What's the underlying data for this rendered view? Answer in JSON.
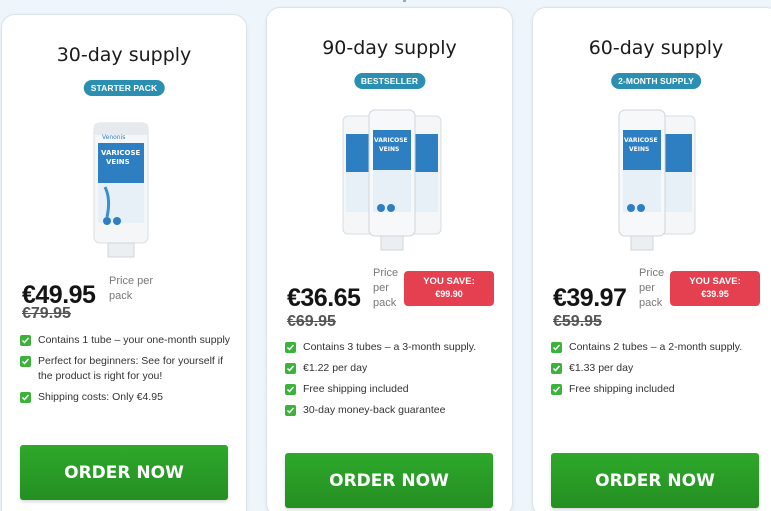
{
  "colors": {
    "badge": "#2a8fb0",
    "button": "#2ea82b",
    "save": "#e4404f",
    "check": "#3bb33a"
  },
  "cards": [
    {
      "title": "30-day supply",
      "badge": "STARTER PACK",
      "product_label": [
        "Varicose",
        "Veins"
      ],
      "price": "€49.95",
      "price_per": "Price per pack",
      "old_price": "€79.95",
      "features": [
        "Contains 1 tube – your one-month supply",
        "Perfect for beginners: See for yourself if the product is right for you!",
        "Shipping costs: Only €4.95"
      ],
      "button": "ORDER NOW"
    },
    {
      "title": "90-day supply",
      "badge": "BESTSELLER",
      "price": "€36.65",
      "price_per": "Price per pack",
      "old_price": "€69.95",
      "save_label": "YOU SAVE:",
      "save_amount": "€99.90",
      "features": [
        "Contains 3 tubes – a 3-month supply.",
        "€1.22 per day",
        "Free shipping included",
        "30-day money-back guarantee"
      ],
      "button": "ORDER NOW"
    },
    {
      "title": "60-day supply",
      "badge": "2-MONTH SUPPLY",
      "price": "€39.97",
      "price_per": "Price per pack",
      "old_price": "€59.95",
      "save_label": "YOU SAVE:",
      "save_amount": "€39.95",
      "features": [
        "Contains 2 tubes – a 2-month supply.",
        "€1.33 per day",
        "Free shipping included"
      ],
      "button": "ORDER NOW"
    }
  ]
}
